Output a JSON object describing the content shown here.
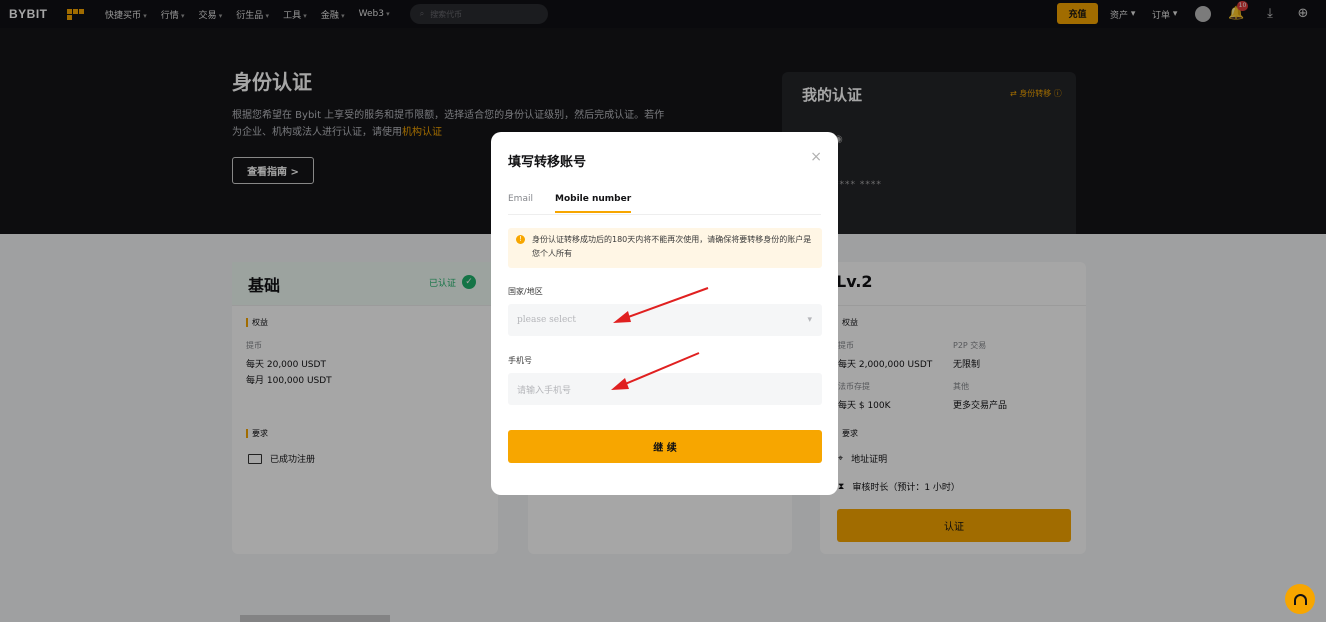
{
  "nav": {
    "logo": "BYBIT",
    "items": [
      "快捷买币",
      "行情",
      "交易",
      "衍生品",
      "工具",
      "金融",
      "Web3"
    ],
    "search_placeholder": "搜索代币",
    "deposit_label": "充值",
    "assets_label": "资产",
    "orders_label": "订单",
    "notification_count": "10"
  },
  "hero": {
    "title": "身份认证",
    "description": "根据您希望在 Bybit 上享受的服务和提币限额，选择适合您的身份认证级别，然后完成认证。若作为企业、机构或法人进行认证，请使用",
    "description_highlight": "机构认证",
    "guide_button": "查看指南 >"
  },
  "my_cert": {
    "title": "我的认证",
    "link": "身份转移",
    "masked": "**** ****"
  },
  "card_basic": {
    "title": "基础",
    "status": "已认证",
    "rights_label": "权益",
    "withdraw_label": "提币",
    "daily": "每天 20,000 USDT",
    "monthly": "每月 100,000 USDT",
    "requirements_label": "要求",
    "requirement_1": "已成功注册"
  },
  "card_lv2": {
    "title": "Lv.2",
    "rights_label": "权益",
    "withdraw_label": "提币",
    "withdraw_value": "每天 2,000,000 USDT",
    "p2p_label": "P2P 交易",
    "p2p_value": "无限制",
    "fiat_label": "法币存提",
    "fiat_value": "每天 $ 100K",
    "other_label": "其他",
    "other_value": "更多交易产品",
    "requirements_label": "要求",
    "requirement_1": "地址证明",
    "requirement_2": "审核时长（预计：1 小时）",
    "button": "认证"
  },
  "modal": {
    "title": "填写转移账号",
    "close": "×",
    "tabs": [
      "Email",
      "Mobile number"
    ],
    "active_tab": "Mobile number",
    "notice": "身份认证转移成功后的180天内将不能再次使用，请确保将要转移身份的账户是您个人所有",
    "country_label": "国家/地区",
    "country_placeholder": "please select",
    "phone_label": "手机号",
    "phone_placeholder": "请输入手机号",
    "continue_label": "继 续"
  },
  "colors": {
    "accent": "#f7a600",
    "success": "#20b26c",
    "annotation_arrow": "#e02020"
  }
}
